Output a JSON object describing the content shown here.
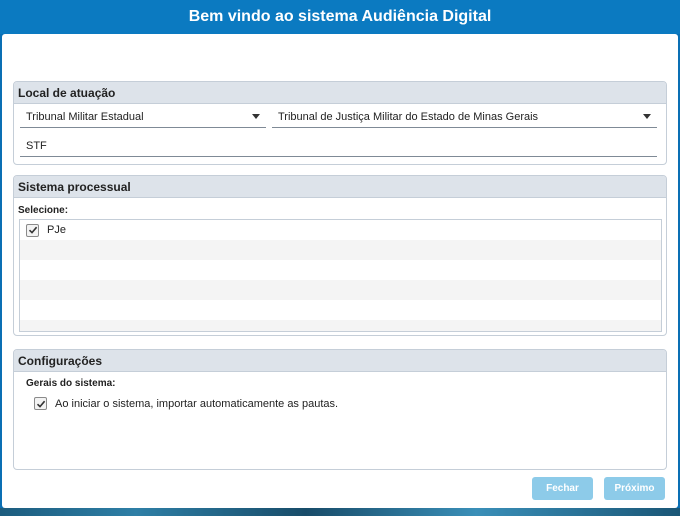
{
  "window": {
    "title": "Bem vindo ao sistema Audiência Digital"
  },
  "local": {
    "header": "Local de atuação",
    "tribunal_tipo": "Tribunal Militar Estadual",
    "tribunal": "Tribunal de Justiça Militar do Estado de Minas Gerais",
    "orgao": "STF"
  },
  "sistema": {
    "header": "Sistema processual",
    "select_label": "Selecione:",
    "items": [
      {
        "label": "PJe",
        "checked": true
      }
    ]
  },
  "config": {
    "header": "Configurações",
    "subheader": "Gerais do sistema:",
    "auto_import_label": "Ao iniciar o sistema, importar automaticamente as pautas.",
    "auto_import_checked": true
  },
  "buttons": {
    "close": "Fechar",
    "next": "Próximo"
  },
  "icons": {
    "dropdown": "chevron-down-icon",
    "check": "check-icon"
  },
  "colors": {
    "titlebar": "#0b7ac1",
    "button": "#8dcbe9",
    "group_header": "#dde3ea"
  }
}
